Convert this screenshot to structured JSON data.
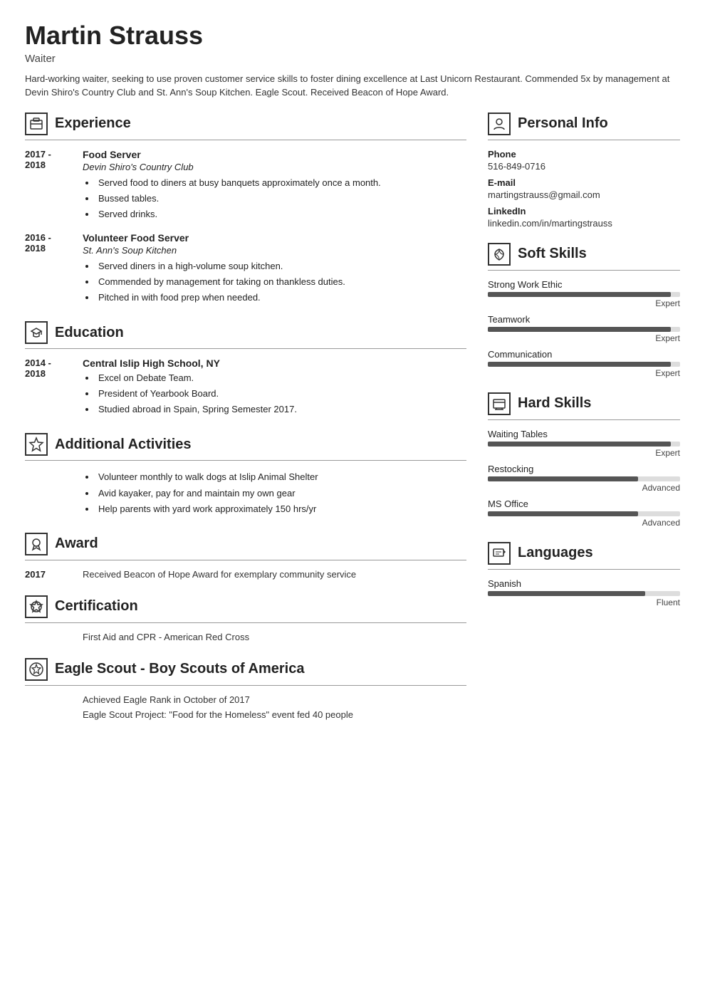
{
  "header": {
    "name": "Martin Strauss",
    "title": "Waiter",
    "summary": "Hard-working waiter, seeking to use proven customer service skills to foster dining excellence at Last Unicorn Restaurant. Commended 5x by management at Devin Shiro's Country Club and St. Ann's Soup Kitchen. Eagle Scout. Received Beacon of Hope Award."
  },
  "experience": {
    "section_title": "Experience",
    "entries": [
      {
        "date": "2017 -\n2018",
        "job_title": "Food Server",
        "company": "Devin Shiro's Country Club",
        "bullets": [
          "Served food to diners at busy banquets approximately once a month.",
          "Bussed tables.",
          "Served drinks."
        ]
      },
      {
        "date": "2016 -\n2018",
        "job_title": "Volunteer Food Server",
        "company": "St. Ann's Soup Kitchen",
        "bullets": [
          "Served diners in a high-volume soup kitchen.",
          "Commended by management for taking on thankless duties.",
          "Pitched in with food prep when needed."
        ]
      }
    ]
  },
  "education": {
    "section_title": "Education",
    "entries": [
      {
        "date": "2014 -\n2018",
        "school": "Central Islip High School, NY",
        "bullets": [
          "Excel on Debate Team.",
          "President of Yearbook Board.",
          "Studied abroad in Spain, Spring Semester 2017."
        ]
      }
    ]
  },
  "additional_activities": {
    "section_title": "Additional Activities",
    "bullets": [
      "Volunteer monthly to walk dogs at Islip Animal Shelter",
      "Avid kayaker, pay for and maintain my own gear",
      "Help parents with yard work approximately 150 hrs/yr"
    ]
  },
  "award": {
    "section_title": "Award",
    "entries": [
      {
        "date": "2017",
        "text": "Received Beacon of Hope Award for exemplary community service"
      }
    ]
  },
  "certification": {
    "section_title": "Certification",
    "entries": [
      {
        "text": "First Aid and CPR - American Red Cross"
      }
    ]
  },
  "eagle_scout": {
    "section_title": "Eagle Scout - Boy Scouts of America",
    "entries": [
      {
        "text": "Achieved Eagle Rank in October of 2017"
      },
      {
        "text": "Eagle Scout Project: \"Food for the Homeless\" event fed 40 people"
      }
    ]
  },
  "personal_info": {
    "section_title": "Personal Info",
    "phone_label": "Phone",
    "phone": "516-849-0716",
    "email_label": "E-mail",
    "email": "martingstrauss@gmail.com",
    "linkedin_label": "LinkedIn",
    "linkedin": "linkedin.com/in/martingstrauss"
  },
  "soft_skills": {
    "section_title": "Soft Skills",
    "skills": [
      {
        "name": "Strong Work Ethic",
        "level": "Expert",
        "pct": 95
      },
      {
        "name": "Teamwork",
        "level": "Expert",
        "pct": 95
      },
      {
        "name": "Communication",
        "level": "Expert",
        "pct": 95
      }
    ]
  },
  "hard_skills": {
    "section_title": "Hard Skills",
    "skills": [
      {
        "name": "Waiting Tables",
        "level": "Expert",
        "pct": 95
      },
      {
        "name": "Restocking",
        "level": "Advanced",
        "pct": 78
      },
      {
        "name": "MS Office",
        "level": "Advanced",
        "pct": 78
      }
    ]
  },
  "languages": {
    "section_title": "Languages",
    "skills": [
      {
        "name": "Spanish",
        "level": "Fluent",
        "pct": 82
      }
    ]
  }
}
